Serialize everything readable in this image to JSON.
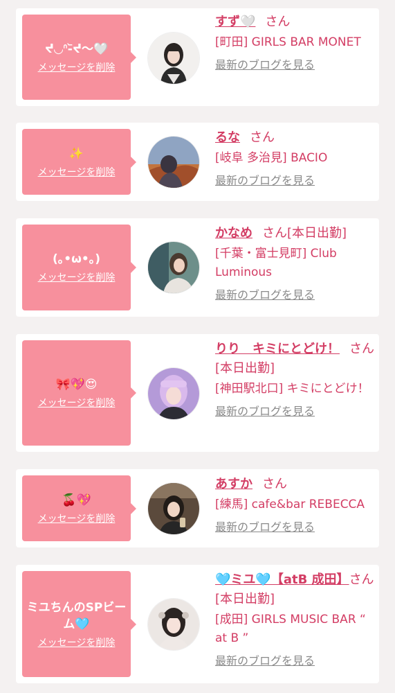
{
  "common": {
    "delete_label": "メッセージを削除",
    "blog_label": "最新のブログを見る",
    "san": "さん"
  },
  "colors": {
    "bubble": "#f7909d",
    "accent": "#d33d64",
    "link_gray": "#8a8a8a"
  },
  "entries": [
    {
      "message": "ᔪ◡ᐢ-᷅ᔪ〜🤍",
      "name": "すず🤍",
      "name_suffix": "さん",
      "shop": "[町田] GIRLS BAR MONET",
      "avatar_icon": "portrait-photo"
    },
    {
      "message": "✨",
      "name": "るな",
      "name_suffix": "さん",
      "shop": "[岐阜 多治見] BACIO",
      "avatar_icon": "portrait-photo"
    },
    {
      "message": "(｡•ω•｡)",
      "name": "かなめ",
      "name_suffix": "さん[本日出勤]",
      "shop": "[千葉・富士見町] Club Luminous",
      "avatar_icon": "portrait-photo"
    },
    {
      "message": "🎀💖😍",
      "name": "りり　キミにとどけ！",
      "name_suffix": "さん[本日出勤]",
      "shop": "[神田駅北口] キミにとどけ！",
      "avatar_icon": "portrait-photo"
    },
    {
      "message": "🍒💖",
      "name": "あすか",
      "name_suffix": "さん",
      "shop": "[練馬] cafe&bar REBECCA",
      "avatar_icon": "portrait-photo"
    },
    {
      "message": "ミユちんのSPビーム🩵",
      "name": "🩵ミユ🩵【atB 成田】",
      "name_suffix": "さん[本日出勤]",
      "shop": "[成田] GIRLS MUSIC BAR “ at B ”",
      "avatar_icon": "portrait-photo"
    }
  ]
}
